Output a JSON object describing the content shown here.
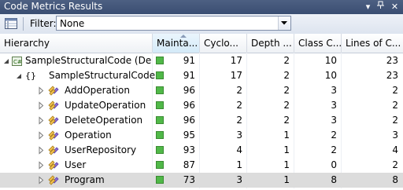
{
  "window": {
    "title": "Code Metrics Results"
  },
  "toolbar": {
    "filter_label": "Filter:",
    "filter_value": "None"
  },
  "columns": [
    {
      "label": "Hierarchy"
    },
    {
      "label": "Mainta..."
    },
    {
      "label": "Cyclo..."
    },
    {
      "label": "Depth ..."
    },
    {
      "label": "Class C..."
    },
    {
      "label": "Lines of C..."
    }
  ],
  "rows": [
    {
      "name": "SampleStructuralCode (Debu",
      "icon": "assembly-icon",
      "mi": "91",
      "cc": "17",
      "doi": "2",
      "coupling": "10",
      "loc": "23"
    },
    {
      "name": "SampleStructuralCode",
      "icon": "namespace-icon",
      "mi": "91",
      "cc": "17",
      "doi": "2",
      "coupling": "10",
      "loc": "23"
    },
    {
      "name": "AddOperation",
      "icon": "class-icon",
      "mi": "96",
      "cc": "2",
      "doi": "2",
      "coupling": "3",
      "loc": "2"
    },
    {
      "name": "UpdateOperation",
      "icon": "class-icon",
      "mi": "96",
      "cc": "2",
      "doi": "2",
      "coupling": "3",
      "loc": "2"
    },
    {
      "name": "DeleteOperation",
      "icon": "class-icon",
      "mi": "96",
      "cc": "2",
      "doi": "2",
      "coupling": "3",
      "loc": "2"
    },
    {
      "name": "Operation",
      "icon": "class-icon",
      "mi": "95",
      "cc": "3",
      "doi": "1",
      "coupling": "2",
      "loc": "3"
    },
    {
      "name": "UserRepository",
      "icon": "class-icon",
      "mi": "93",
      "cc": "4",
      "doi": "1",
      "coupling": "2",
      "loc": "4"
    },
    {
      "name": "User",
      "icon": "class-icon",
      "mi": "87",
      "cc": "1",
      "doi": "1",
      "coupling": "0",
      "loc": "2"
    },
    {
      "name": "Program",
      "icon": "class-icon",
      "mi": "73",
      "cc": "3",
      "doi": "1",
      "coupling": "8",
      "loc": "8"
    }
  ],
  "colors": {
    "rating_green": "#50b848",
    "title_bar": "#3f5377",
    "selected_row": "#dcdcdc"
  }
}
